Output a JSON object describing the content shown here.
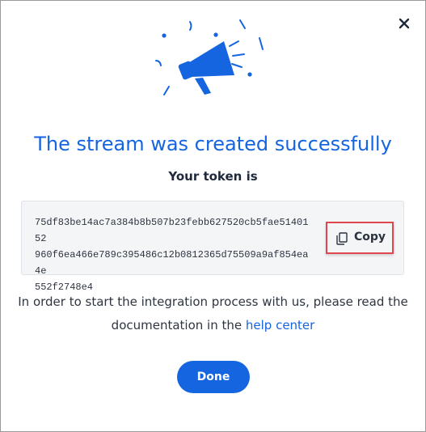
{
  "modal": {
    "title": "The stream was created successfully",
    "subtitle": "Your token is",
    "token": {
      "line1": "75df83be14ac7a384b8b507b23febb627520cb5fae5140152",
      "line2": "960f6ea466e789c395486c12b0812365d75509a9af854ea4e",
      "line3": "552f2748e4"
    },
    "copy_label": "Copy",
    "info": {
      "line1": "In order to start the integration process with us, please read the",
      "line2_prefix": "documentation in the ",
      "link_text": "help center"
    },
    "done_label": "Done"
  },
  "icons": {
    "close": "close-icon",
    "megaphone": "megaphone-icon",
    "copy": "copy-icon"
  },
  "colors": {
    "accent": "#1565e0",
    "highlight_border": "#e0464f",
    "token_bg": "#f4f5f7",
    "text": "#2e3540"
  }
}
